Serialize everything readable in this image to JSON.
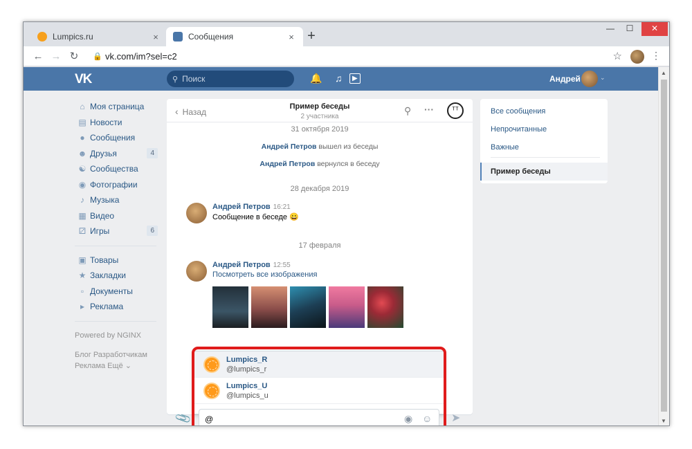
{
  "browser": {
    "tabs": [
      {
        "title": "Lumpics.ru",
        "close": "×"
      },
      {
        "title": "Сообщения",
        "close": "×"
      }
    ],
    "new_tab": "+",
    "win_min": "—",
    "win_max": "☐",
    "win_close": "✕",
    "url": "vk.com/im?sel=c2"
  },
  "header": {
    "logo": "VK",
    "search_placeholder": "Поиск",
    "user_name": "Андрей"
  },
  "sidebar": {
    "items": [
      {
        "label": "Моя страница"
      },
      {
        "label": "Новости"
      },
      {
        "label": "Сообщения"
      },
      {
        "label": "Друзья",
        "badge": "4"
      },
      {
        "label": "Сообщества"
      },
      {
        "label": "Фотографии"
      },
      {
        "label": "Музыка"
      },
      {
        "label": "Видео"
      },
      {
        "label": "Игры",
        "badge": "6"
      }
    ],
    "items2": [
      {
        "label": "Товары"
      },
      {
        "label": "Закладки"
      },
      {
        "label": "Документы"
      },
      {
        "label": "Реклама"
      }
    ],
    "powered": "Powered by NGINX",
    "footer_line1": "Блог   Разработчикам",
    "footer_line2": "Реклама   Ещё ⌄"
  },
  "chat": {
    "back_label": "Назад",
    "title": "Пример беседы",
    "subtitle": "2 участника",
    "dates": [
      "31 октября 2019",
      "28 декабря 2019",
      "17 февраля"
    ],
    "service": [
      {
        "who": "Андрей Петров",
        "text": " вышел из беседы"
      },
      {
        "who": "Андрей Петров",
        "text": " вернулся в беседу"
      }
    ],
    "messages": [
      {
        "author": "Андрей Петров",
        "time": "16:21",
        "text": "Сообщение в беседе 😀"
      },
      {
        "author": "Андрей Петров",
        "time": "12:55",
        "text": "Посмотреть все изображения"
      }
    ],
    "mentions": [
      {
        "name": "Lumpics_R",
        "nick": "@lumpics_r"
      },
      {
        "name": "Lumpics_U",
        "nick": "@lumpics_u"
      }
    ],
    "input_value": "@"
  },
  "right_panel": {
    "items": [
      "Все сообщения",
      "Непрочитанные",
      "Важные"
    ],
    "active": "Пример беседы"
  },
  "colors": {
    "vk_blue": "#4a76a8",
    "link": "#2a5885",
    "highlight": "#e01b1b"
  }
}
